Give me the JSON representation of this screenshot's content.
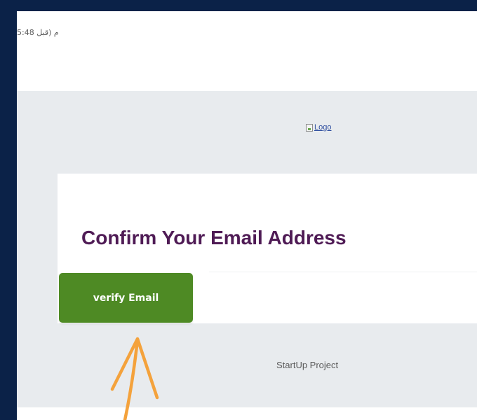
{
  "email": {
    "timestamp": "5:48 م (قبل",
    "logo_alt": "Logo",
    "title": "Confirm Your Email Address",
    "verify_button_label": "verify Email",
    "footer_text": "StartUp Project"
  },
  "colors": {
    "background_outer": "#0b2248",
    "band_gray": "#e8ebee",
    "title_purple": "#4f1b55",
    "button_green": "#4e8a24",
    "annotation_orange": "#f4a23c",
    "link_blue": "#2f4fa0"
  },
  "annotation": {
    "icon": "arrow-up-icon"
  }
}
